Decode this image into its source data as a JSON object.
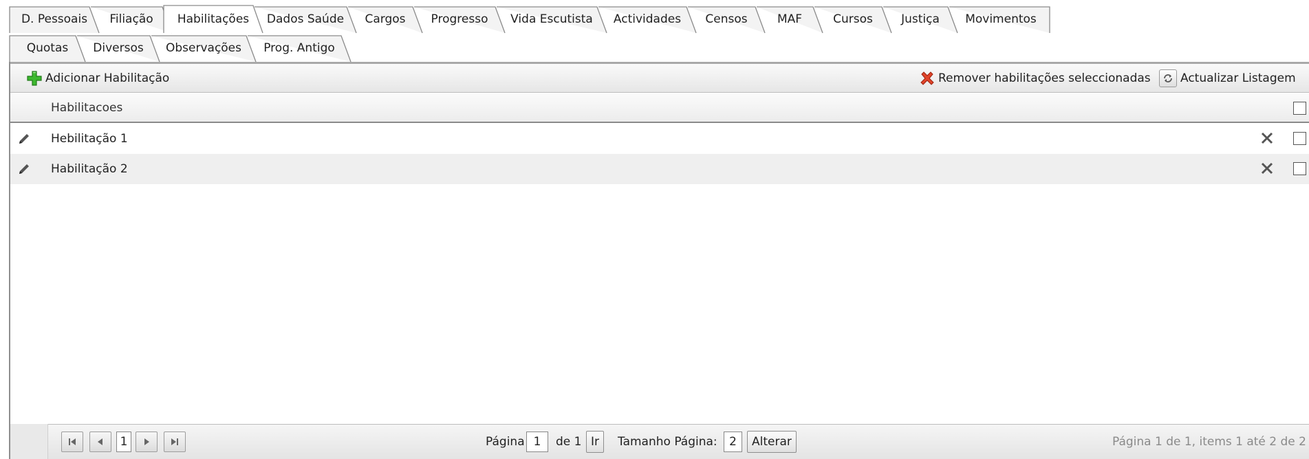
{
  "tabs_row1": [
    {
      "label": "D. Pessoais",
      "active": false
    },
    {
      "label": "Filiação",
      "active": false
    },
    {
      "label": "Habilitações",
      "active": true
    },
    {
      "label": "Dados Saúde",
      "active": false
    },
    {
      "label": "Cargos",
      "active": false
    },
    {
      "label": "Progresso",
      "active": false
    },
    {
      "label": "Vida Escutista",
      "active": false
    },
    {
      "label": "Actividades",
      "active": false
    },
    {
      "label": "Censos",
      "active": false
    },
    {
      "label": "MAF",
      "active": false
    },
    {
      "label": "Cursos",
      "active": false
    },
    {
      "label": "Justiça",
      "active": false
    },
    {
      "label": "Movimentos",
      "active": false
    }
  ],
  "tabs_row2": [
    {
      "label": "Quotas",
      "active": false
    },
    {
      "label": "Diversos",
      "active": false
    },
    {
      "label": "Observações",
      "active": false
    },
    {
      "label": "Prog. Antigo",
      "active": false
    }
  ],
  "toolbar": {
    "add_label": "Adicionar Habilitação",
    "remove_label": "Remover habilitações seleccionadas",
    "refresh_label": "Actualizar Listagem"
  },
  "grid": {
    "column_header": "Habilitacoes",
    "rows": [
      {
        "name": "Hebilitação 1"
      },
      {
        "name": "Habilitação 2"
      }
    ]
  },
  "pager": {
    "page_label": "Página",
    "current_page": "1",
    "of_label": "de 1",
    "go_label": "Ir",
    "size_label": "Tamanho Página:",
    "page_size": "2",
    "change_label": "Alterar",
    "status": "Página 1 de 1, items 1 até 2 de 2",
    "nav_page": "1"
  },
  "colors": {
    "add_icon": "#3cb82e",
    "remove_icon": "#e0442a",
    "tab_border": "#8a8a8a"
  }
}
